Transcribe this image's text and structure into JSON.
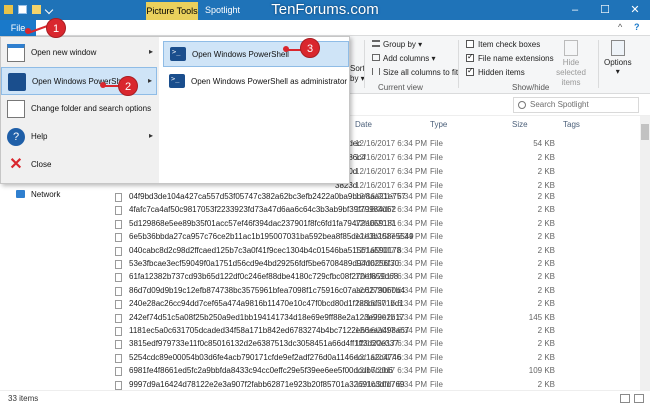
{
  "window": {
    "tools_context": "Picture Tools",
    "title": "Spotlight",
    "watermark": "TenForums.com",
    "minimize": "–",
    "maximize": "☐",
    "close": "✕"
  },
  "tabs": {
    "file": "File",
    "help_glyph": "?",
    "collapse_glyph": "^"
  },
  "ribbon": {
    "sort_partial": "Sort\nby",
    "group_by": "Group by ▾",
    "add_columns": "Add columns ▾",
    "size_all_columns": "Size all columns to fit",
    "current_view": "Current view",
    "item_check_boxes": "Item check boxes",
    "file_name_extensions": "File name extensions",
    "hidden_items": "Hidden items",
    "hide_selected_items": "Hide selected items",
    "show_hide": "Show/hide",
    "options": "Options",
    "checks": {
      "item_check_boxes": false,
      "file_name_extensions": true,
      "hidden_items": true
    }
  },
  "search": {
    "placeholder": "Search Spotlight"
  },
  "columns": {
    "date": "Date",
    "type": "Type",
    "size": "Size",
    "tags": "Tags"
  },
  "nav": {
    "network": "Network"
  },
  "file_menu": {
    "left": [
      {
        "label": "Open new window",
        "arrow": "▸"
      },
      {
        "label": "Open Windows PowerShell",
        "arrow": "▸"
      },
      {
        "label": "Change folder and search options",
        "arrow": ""
      },
      {
        "label": "Help",
        "arrow": "▸"
      },
      {
        "label": "Close",
        "arrow": ""
      }
    ],
    "right": [
      {
        "label": "Open Windows PowerShell"
      },
      {
        "label": "Open Windows PowerShell as administrator"
      }
    ]
  },
  "steps": [
    "1",
    "2",
    "3"
  ],
  "rows_partial": [
    {
      "name": "6b9dec",
      "date": "12/16/2017 6:34 PM",
      "type": "File",
      "size": "54 KB"
    },
    {
      "name": "76586c4",
      "date": "12/16/2017 6:34 PM",
      "type": "File",
      "size": "2 KB"
    },
    {
      "name": "be50d",
      "date": "12/16/2017 6:34 PM",
      "type": "File",
      "size": "2 KB"
    },
    {
      "name": "3823d",
      "date": "12/16/2017 6:34 PM",
      "type": "File",
      "size": "2 KB"
    }
  ],
  "rows": [
    {
      "name": "04f9bd3de104a427ca557d53f05747c382a62bc3efb2422a0ba9bbe8aa21e757",
      "date": "12/16/2017 6:34 PM",
      "type": "File",
      "size": "2 KB"
    },
    {
      "name": "4fafc7ca4af50c9817053f2233923fd73a47d6aa6c64c3b3ab9bf39f79984d62",
      "date": "12/16/2017 6:34 PM",
      "type": "File",
      "size": "2 KB"
    },
    {
      "name": "5d129868e5ee89b35f01acc57ef46f394dac237901f8fc6fd1fa79472a059181",
      "date": "12/16/2017 6:34 PM",
      "type": "File",
      "size": "2 KB"
    },
    {
      "name": "6e5b36bbda27ca957c76ce2b11ac1b195007031ba592bea8f85de1e3b158e5549",
      "date": "12/16/2017 6:34 PM",
      "type": "File",
      "size": "2 KB"
    },
    {
      "name": "040cabc8d2c98d2ffcaed125b7c3a0f41f9cec1304b4c01546ba51561a590178",
      "date": "12/16/2017 6:34 PM",
      "type": "File",
      "size": "2 KB"
    },
    {
      "name": "53e3fbcae3ecf59049f0a1751d56cd9e4bd29256fdf5be6708489d94d0256f30",
      "date": "12/16/2017 6:34 PM",
      "type": "File",
      "size": "2 KB"
    },
    {
      "name": "61fa12382b737cd93b65d122df0c246ef88dbe4180c729cfbc08f270ef859d68",
      "date": "12/16/2017 6:34 PM",
      "type": "File",
      "size": "2 KB"
    },
    {
      "name": "86d7d09d9b19c12efb874738bc3575961bfea7098f1c75916c07aac6279060b4",
      "date": "12/16/2017 6:34 PM",
      "type": "File",
      "size": "2 KB"
    },
    {
      "name": "240e28ac26cc94dd7cef65a474a9816b11470e10c47f0bcd80d1f288dd571bd1",
      "date": "12/16/2017 6:34 PM",
      "type": "File",
      "size": "2 KB"
    },
    {
      "name": "242ef74d51c5a08f25b250a9ed1bb194141734d18e69e9ff88e2a123e99e2b17",
      "date": "12/16/2017 6:34 PM",
      "type": "File",
      "size": "145 KB"
    },
    {
      "name": "1181ec5a0c631705dcaded34f58a171b842ed6783274b4bc7122e66eaa498a67",
      "date": "12/16/2017 6:34 PM",
      "type": "File",
      "size": "2 KB"
    },
    {
      "name": "3815edf979733e11f0c85016132d2e6387513dc3058451a66d4ff1ff3d20e337",
      "date": "12/16/2017 6:34 PM",
      "type": "File",
      "size": "2 KB"
    },
    {
      "name": "5254cdc89e00054b03d6fe4acb790171cfde9ef2adf276d0a1146ecc1a2c4746",
      "date": "12/16/2017 6:34 PM",
      "type": "File",
      "size": "2 KB"
    },
    {
      "name": "6981fe4f8661ed5fc2a9bbfda8433c94cc0effc29e5f39ee6ee5f00dcdb7cdb6",
      "date": "12/16/2017 6:34 PM",
      "type": "File",
      "size": "109 KB"
    },
    {
      "name": "9997d9a16424d78122e2e3a907f2fabb62871e923b20f85701a32691c3dfd769",
      "date": "12/16/2017 6:34 PM",
      "type": "File",
      "size": "2 KB"
    }
  ],
  "status": {
    "items": "33 items"
  }
}
